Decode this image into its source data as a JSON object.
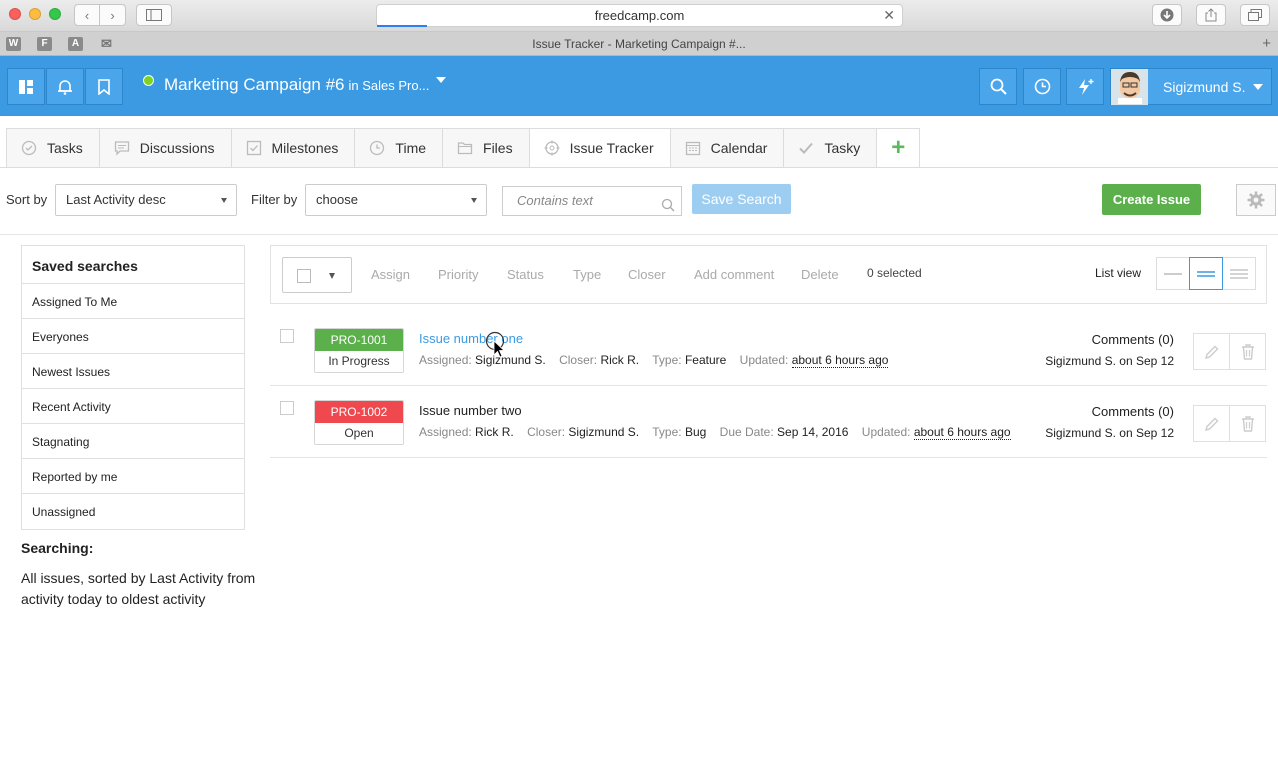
{
  "browser": {
    "url": "freedcamp.com",
    "tab_title": "Issue Tracker - Marketing Campaign #...",
    "favicons": [
      "W",
      "F",
      "A"
    ]
  },
  "header": {
    "project_name": "Marketing Campaign #6",
    "project_sub": "in Sales Pro...",
    "user_name": "Sigizmund S.",
    "accent": "#3b9ae1",
    "status_dot": "#7ed321"
  },
  "tabs": [
    {
      "label": "Tasks",
      "icon": "check-circle-icon"
    },
    {
      "label": "Discussions",
      "icon": "speech-bubble-icon"
    },
    {
      "label": "Milestones",
      "icon": "checkbox-icon"
    },
    {
      "label": "Time",
      "icon": "clock-icon"
    },
    {
      "label": "Files",
      "icon": "folder-icon"
    },
    {
      "label": "Issue Tracker",
      "icon": "crosshair-icon"
    },
    {
      "label": "Calendar",
      "icon": "calendar-icon"
    },
    {
      "label": "Tasky",
      "icon": "checkmark-icon"
    }
  ],
  "filters": {
    "sort_label": "Sort by",
    "sort_value": "Last Activity desc",
    "filter_label": "Filter by",
    "filter_value": "choose",
    "search_placeholder": "Contains text",
    "save_search": "Save Search",
    "create_issue": "Create Issue"
  },
  "sidebar": {
    "title": "Saved searches",
    "items": [
      {
        "label": "Assigned To Me"
      },
      {
        "label": "Everyones"
      },
      {
        "label": "Newest Issues"
      },
      {
        "label": "Recent Activity"
      },
      {
        "label": "Stagnating"
      },
      {
        "label": "Reported by me"
      },
      {
        "label": "Unassigned"
      }
    ],
    "searching_title": "Searching:",
    "searching_desc": "All issues, sorted by Last Activity from activity today to oldest activity"
  },
  "toolbar": {
    "actions": [
      "Assign",
      "Priority",
      "Status",
      "Type",
      "Closer",
      "Add comment",
      "Delete"
    ],
    "selected": "0 selected",
    "list_view": "List view"
  },
  "issues": [
    {
      "id": "PRO-1001",
      "status": "In Progress",
      "status_color": "#5cb04b",
      "title": "Issue number one",
      "assigned_label": "Assigned:",
      "assigned": "Sigizmund S.",
      "closer_label": "Closer:",
      "closer": "Rick R.",
      "type_label": "Type:",
      "type": "Feature",
      "updated_label": "Updated:",
      "updated": "about 6 hours ago",
      "comments": "Comments (0)",
      "by": "Sigizmund S. on Sep 12"
    },
    {
      "id": "PRO-1002",
      "status": "Open",
      "status_color": "#f0484f",
      "title": "Issue number two",
      "assigned_label": "Assigned:",
      "assigned": "Rick R.",
      "closer_label": "Closer:",
      "closer": "Sigizmund S.",
      "type_label": "Type:",
      "type": "Bug",
      "due_label": "Due Date:",
      "due": "Sep 14, 2016",
      "updated_label": "Updated:",
      "updated": "about 6 hours ago",
      "comments": "Comments (0)",
      "by": "Sigizmund S. on Sep 12"
    }
  ]
}
